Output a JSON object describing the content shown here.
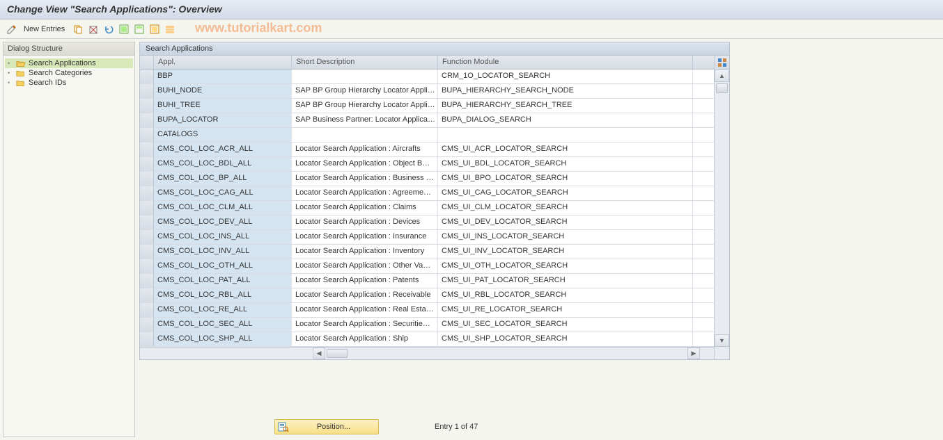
{
  "title": "Change View \"Search Applications\": Overview",
  "toolbar": {
    "new_entries": "New Entries"
  },
  "watermark": "www.tutorialkart.com",
  "sidebar": {
    "header": "Dialog Structure",
    "items": [
      {
        "label": "Search Applications",
        "active": true,
        "open": true
      },
      {
        "label": "Search Categories",
        "active": false,
        "open": false
      },
      {
        "label": "Search IDs",
        "active": false,
        "open": false
      }
    ]
  },
  "table": {
    "title": "Search Applications",
    "columns": [
      "Appl.",
      "Short Description",
      "Function Module"
    ],
    "rows": [
      {
        "appl": "BBP",
        "desc": "",
        "func": "CRM_1O_LOCATOR_SEARCH"
      },
      {
        "appl": "BUHI_NODE",
        "desc": "SAP BP Group Hierarchy Locator Appli…",
        "func": "BUPA_HIERARCHY_SEARCH_NODE"
      },
      {
        "appl": "BUHI_TREE",
        "desc": "SAP BP Group Hierarchy Locator Appli…",
        "func": "BUPA_HIERARCHY_SEARCH_TREE"
      },
      {
        "appl": "BUPA_LOCATOR",
        "desc": "SAP Business Partner: Locator Applica…",
        "func": "BUPA_DIALOG_SEARCH"
      },
      {
        "appl": "CATALOGS",
        "desc": "",
        "func": ""
      },
      {
        "appl": "CMS_COL_LOC_ACR_ALL",
        "desc": "Locator Search Application : Aircrafts",
        "func": "CMS_UI_ACR_LOCATOR_SEARCH"
      },
      {
        "appl": "CMS_COL_LOC_BDL_ALL",
        "desc": "Locator Search Application : Object B…",
        "func": "CMS_UI_BDL_LOCATOR_SEARCH"
      },
      {
        "appl": "CMS_COL_LOC_BP_ALL",
        "desc": "Locator Search Application : Business …",
        "func": "CMS_UI_BPO_LOCATOR_SEARCH"
      },
      {
        "appl": "CMS_COL_LOC_CAG_ALL",
        "desc": "Locator Search Application : Agreeme…",
        "func": "CMS_UI_CAG_LOCATOR_SEARCH"
      },
      {
        "appl": "CMS_COL_LOC_CLM_ALL",
        "desc": "Locator Search Application : Claims",
        "func": "CMS_UI_CLM_LOCATOR_SEARCH"
      },
      {
        "appl": "CMS_COL_LOC_DEV_ALL",
        "desc": "Locator Search Application : Devices",
        "func": "CMS_UI_DEV_LOCATOR_SEARCH"
      },
      {
        "appl": "CMS_COL_LOC_INS_ALL",
        "desc": "Locator Search Application : Insurance",
        "func": "CMS_UI_INS_LOCATOR_SEARCH"
      },
      {
        "appl": "CMS_COL_LOC_INV_ALL",
        "desc": "Locator Search Application : Inventory",
        "func": "CMS_UI_INV_LOCATOR_SEARCH"
      },
      {
        "appl": "CMS_COL_LOC_OTH_ALL",
        "desc": "Locator Search Application : Other Va…",
        "func": "CMS_UI_OTH_LOCATOR_SEARCH"
      },
      {
        "appl": "CMS_COL_LOC_PAT_ALL",
        "desc": "Locator Search Application : Patents",
        "func": "CMS_UI_PAT_LOCATOR_SEARCH"
      },
      {
        "appl": "CMS_COL_LOC_RBL_ALL",
        "desc": "Locator Search Application : Receivable",
        "func": "CMS_UI_RBL_LOCATOR_SEARCH"
      },
      {
        "appl": "CMS_COL_LOC_RE_ALL",
        "desc": "Locator Search Application : Real Esta…",
        "func": "CMS_UI_RE_LOCATOR_SEARCH"
      },
      {
        "appl": "CMS_COL_LOC_SEC_ALL",
        "desc": "Locator Search Application : Securitie…",
        "func": "CMS_UI_SEC_LOCATOR_SEARCH"
      },
      {
        "appl": "CMS_COL_LOC_SHP_ALL",
        "desc": "Locator Search Application : Ship",
        "func": "CMS_UI_SHP_LOCATOR_SEARCH"
      }
    ]
  },
  "footer": {
    "position_label": "Position...",
    "entry_info": "Entry 1 of 47"
  }
}
